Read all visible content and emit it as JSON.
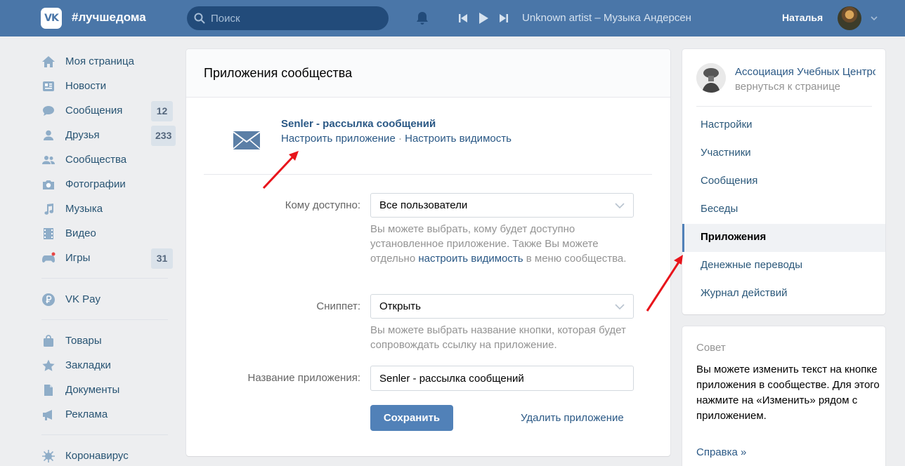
{
  "header": {
    "logo": "VK",
    "brand": "#лучшедома",
    "search_placeholder": "Поиск",
    "player_text": "Unknown artist – Музыка Андерсен",
    "user_name": "Наталья"
  },
  "leftnav": {
    "items": [
      {
        "label": "Моя страница"
      },
      {
        "label": "Новости"
      },
      {
        "label": "Сообщения",
        "badge": "12"
      },
      {
        "label": "Друзья",
        "badge": "233"
      },
      {
        "label": "Сообщества"
      },
      {
        "label": "Фотографии"
      },
      {
        "label": "Музыка"
      },
      {
        "label": "Видео"
      },
      {
        "label": "Игры",
        "badge": "31"
      }
    ],
    "vkpay": "VK Pay",
    "items2": [
      {
        "label": "Товары"
      },
      {
        "label": "Закладки"
      },
      {
        "label": "Документы"
      },
      {
        "label": "Реклама"
      }
    ],
    "corona": "Коронавирус"
  },
  "main": {
    "title": "Приложения сообщества",
    "app_name": "Senler - рассылка сообщений",
    "link_configure": "Настроить приложение",
    "link_sep": " · ",
    "link_visibility": "Настроить видимость",
    "access_label": "Кому доступно:",
    "access_value": "Все пользователи",
    "access_hint_1": "Вы можете выбрать, кому будет доступно установленное приложение. Также Вы можете отдельно ",
    "access_hint_link": "настроить видимость",
    "access_hint_2": " в меню сообщества.",
    "snippet_label": "Сниппет:",
    "snippet_value": "Открыть",
    "snippet_hint": "Вы можете выбрать название кнопки, которая будет сопровождать ссылку на приложение.",
    "name_label": "Название приложения:",
    "name_value": "Senler - рассылка сообщений",
    "save": "Сохранить",
    "delete": "Удалить приложение"
  },
  "side": {
    "community_name": "Ассоциация Учебных Центров",
    "back": "вернуться к странице",
    "items": [
      "Настройки",
      "Участники",
      "Сообщения",
      "Беседы",
      "Приложения",
      "Денежные переводы",
      "Журнал действий"
    ],
    "active_index": 4
  },
  "tip": {
    "title": "Совет",
    "text": "Вы можете изменить текст на кнопке приложения в сообществе. Для этого нажмите на «Изменить» рядом с приложением.",
    "link": "Справка »"
  },
  "colors": {
    "header": "#4a76a8",
    "link": "#2a5885",
    "button": "#5181b8",
    "annotation_arrow": "#e8141b"
  }
}
